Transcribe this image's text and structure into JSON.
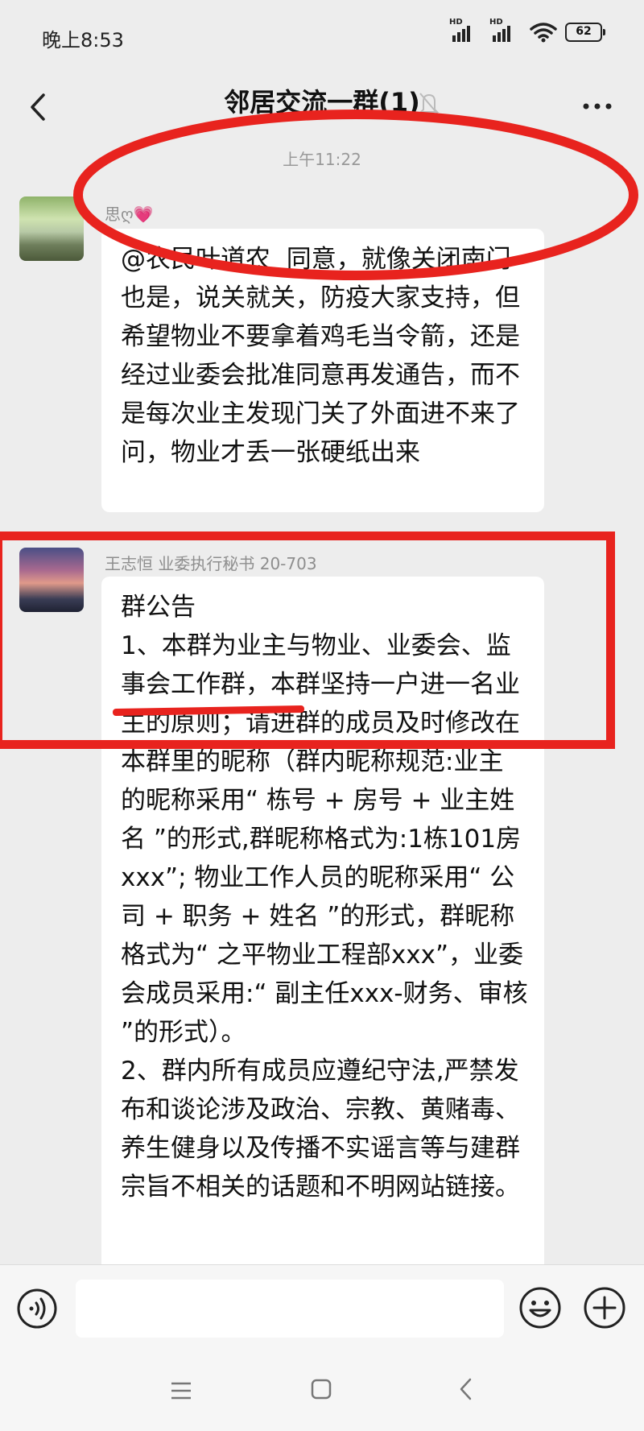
{
  "status_bar": {
    "time": "晚上8:53",
    "hd_label": "HD",
    "battery": "62"
  },
  "header": {
    "title": "邻居交流一群(1)"
  },
  "timestamp": "上午11:22",
  "messages": [
    {
      "sender": "思ღ💗",
      "text": "@农民叶道农  同意，就像关闭南门也是，说关就关，防疫大家支持，但希望物业不要拿着鸡毛当令箭，还是经过业委会批准同意再发通告，而不是每次业主发现门关了外面进不来了问，物业才丢一张硬纸出来"
    },
    {
      "sender": "王志恒 业委执行秘书 20-703",
      "text": "群公告\n1、本群为业主与物业、业委会、监事会工作群，本群坚持一户进一名业主的原则；请进群的成员及时修改在本群里的昵称（群内昵称规范:业主的昵称采用“ 栋号 + 房号 + 业主姓名 ”的形式,群昵称格式为:1栋101房 xxx”; 物业工作人员的昵称采用“ 公司 + 职务 + 姓名 ”的形式，群昵称格式为“ 之平物业工程部xxx”，业委会成员采用:“ 副主任xxx-财务、审核 ”的形式）。\n2、群内所有成员应遵纪守法,严禁发布和谈论涉及政治、宗教、黄赌毒、养生健身以及传播不实谣言等与建群宗旨不相关的话题和不明网站链接。"
    }
  ],
  "input": {
    "placeholder": ""
  },
  "icons": {
    "back": "back-arrow-icon",
    "mute": "mute-bell-icon",
    "more": "more-dots-icon",
    "voice": "voice-icon",
    "emoji": "emoji-icon",
    "plus": "plus-icon",
    "nav_menu": "nav-menu-icon",
    "nav_home": "nav-home-icon",
    "nav_back": "nav-back-icon"
  },
  "colors": {
    "annotation": "#e8231e",
    "background": "#ededed",
    "bubble": "#ffffff"
  }
}
